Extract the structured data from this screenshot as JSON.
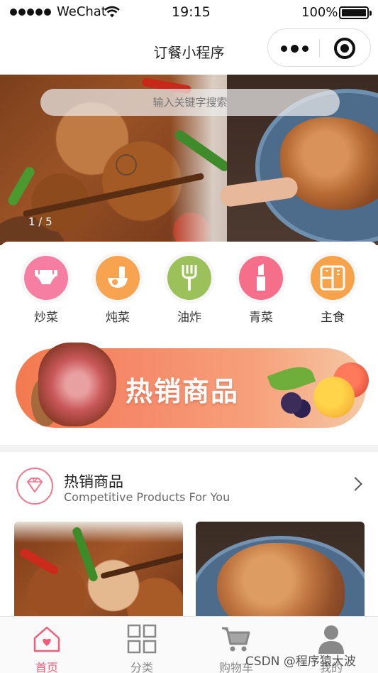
{
  "status_bar": {
    "carrier": "WeChat",
    "time": "19:15",
    "battery": "100%"
  },
  "nav": {
    "title": "订餐小程序"
  },
  "banner": {
    "search_placeholder": "输入关键字搜索",
    "pager": "1 / 5"
  },
  "categories": [
    {
      "label": "炒菜",
      "icon": "diaper-icon",
      "color": "#f77ea3"
    },
    {
      "label": "炖菜",
      "icon": "bottle-bowl-icon",
      "color": "#f7a350"
    },
    {
      "label": "油炸",
      "icon": "fork-icon",
      "color": "#9cc05a"
    },
    {
      "label": "青菜",
      "icon": "lipstick-icon",
      "color": "#f56f8b"
    },
    {
      "label": "主食",
      "icon": "fridge-icon",
      "color": "#f7a34b"
    }
  ],
  "promo": {
    "text": "热销商品"
  },
  "hot_section": {
    "title": "热销商品",
    "subtitle": "Competitive Products For You"
  },
  "tabs": [
    {
      "label": "首页",
      "icon": "home-icon",
      "active": true
    },
    {
      "label": "分类",
      "icon": "grid-icon",
      "active": false
    },
    {
      "label": "购物车",
      "icon": "cart-icon",
      "active": false
    },
    {
      "label": "我的",
      "icon": "user-icon",
      "active": false
    }
  ],
  "watermark": "CSDN @程序猿大波",
  "colors": {
    "accent": "#f05e7b",
    "tab_inactive": "#888888"
  }
}
